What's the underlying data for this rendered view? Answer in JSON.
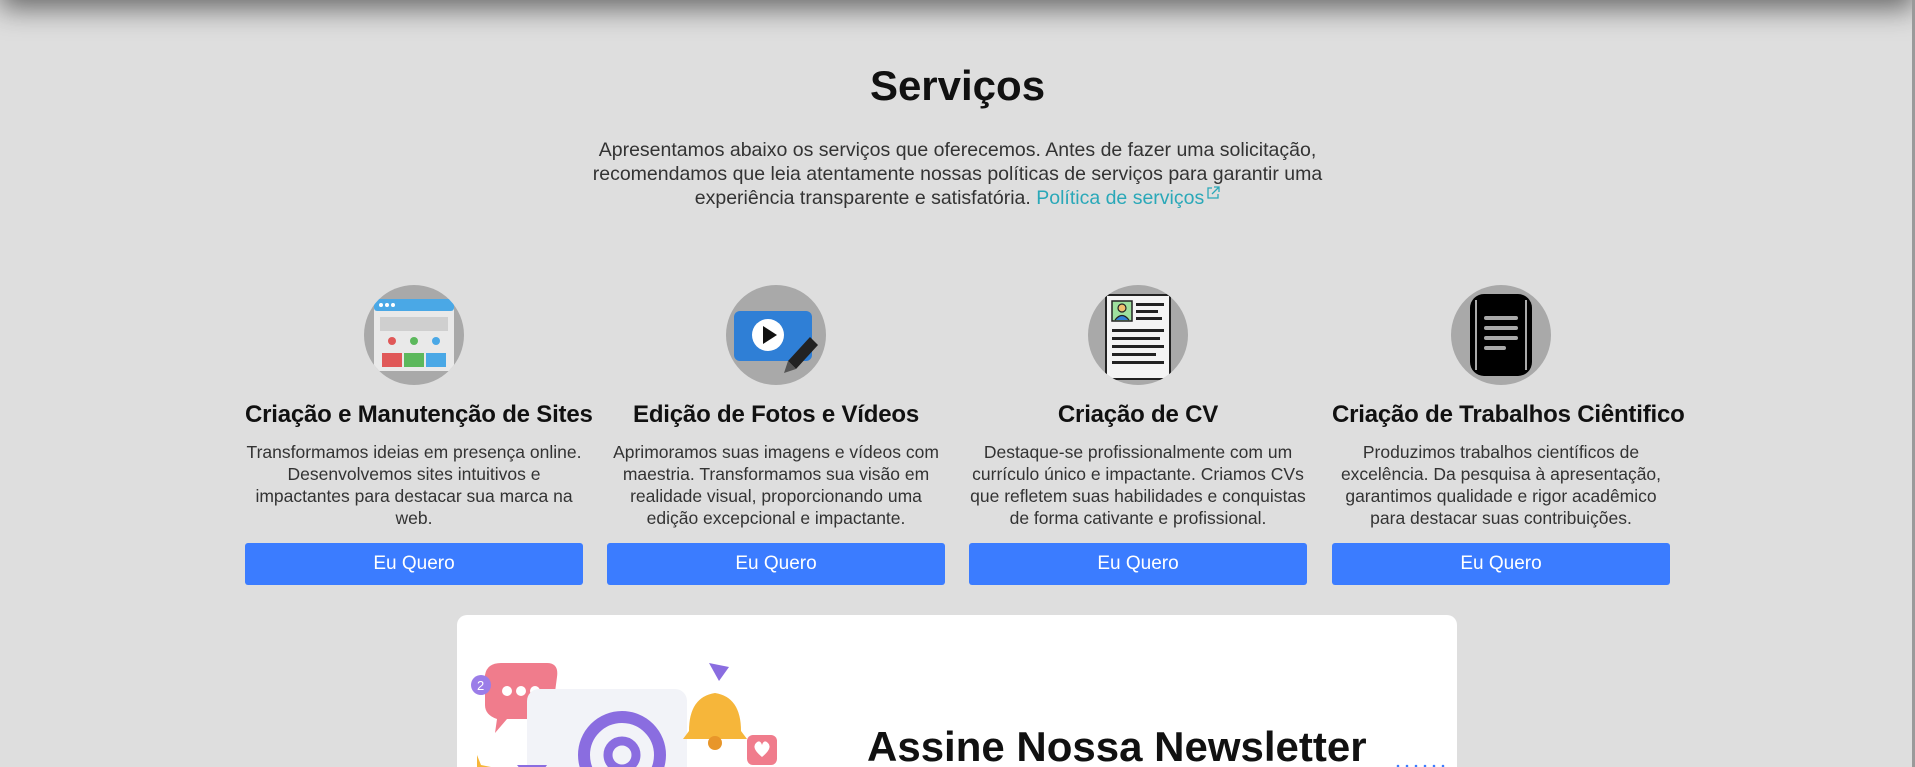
{
  "section": {
    "title": "Serviços",
    "intro": "Apresentamos abaixo os serviços que oferecemos. Antes de fazer uma solicitação, recomendamos que leia atentamente nossas políticas de serviços para garantir uma experiência transparente e satisfatória.",
    "policy_link": "Política de serviços"
  },
  "services": [
    {
      "icon": "website-icon",
      "title": "Criação e Manutenção de Sites",
      "description": "Transformamos ideias em presença online. Desenvolvemos sites intuitivos e impactantes para destacar sua marca na web.",
      "button": "Eu Quero"
    },
    {
      "icon": "video-edit-icon",
      "title": "Edição de Fotos e Vídeos",
      "description": "Aprimoramos suas imagens e vídeos com maestria. Transformamos sua visão em realidade visual, proporcionando uma edição excepcional e impactante.",
      "button": "Eu Quero"
    },
    {
      "icon": "resume-icon",
      "title": "Criação de CV",
      "description": "Destaque-se profissionalmente com um currículo único e impactante. Criamos CVs que refletem suas habilidades e conquistas de forma cativante e profissional.",
      "button": "Eu Quero"
    },
    {
      "icon": "document-icon",
      "title": "Criação de Trabalhos Ciêntifico",
      "description": "Produzimos trabalhos científicos de excelência. Da pesquisa à apresentação, garantimos qualidade e rigor acadêmico para destacar suas contribuições.",
      "button": "Eu Quero"
    }
  ],
  "newsletter": {
    "title": "Assine Nossa Newsletter"
  },
  "colors": {
    "background": "#dedede",
    "button": "#3b7cff",
    "link": "#2aa8b8",
    "icon_circle": "#a9a9a9"
  }
}
